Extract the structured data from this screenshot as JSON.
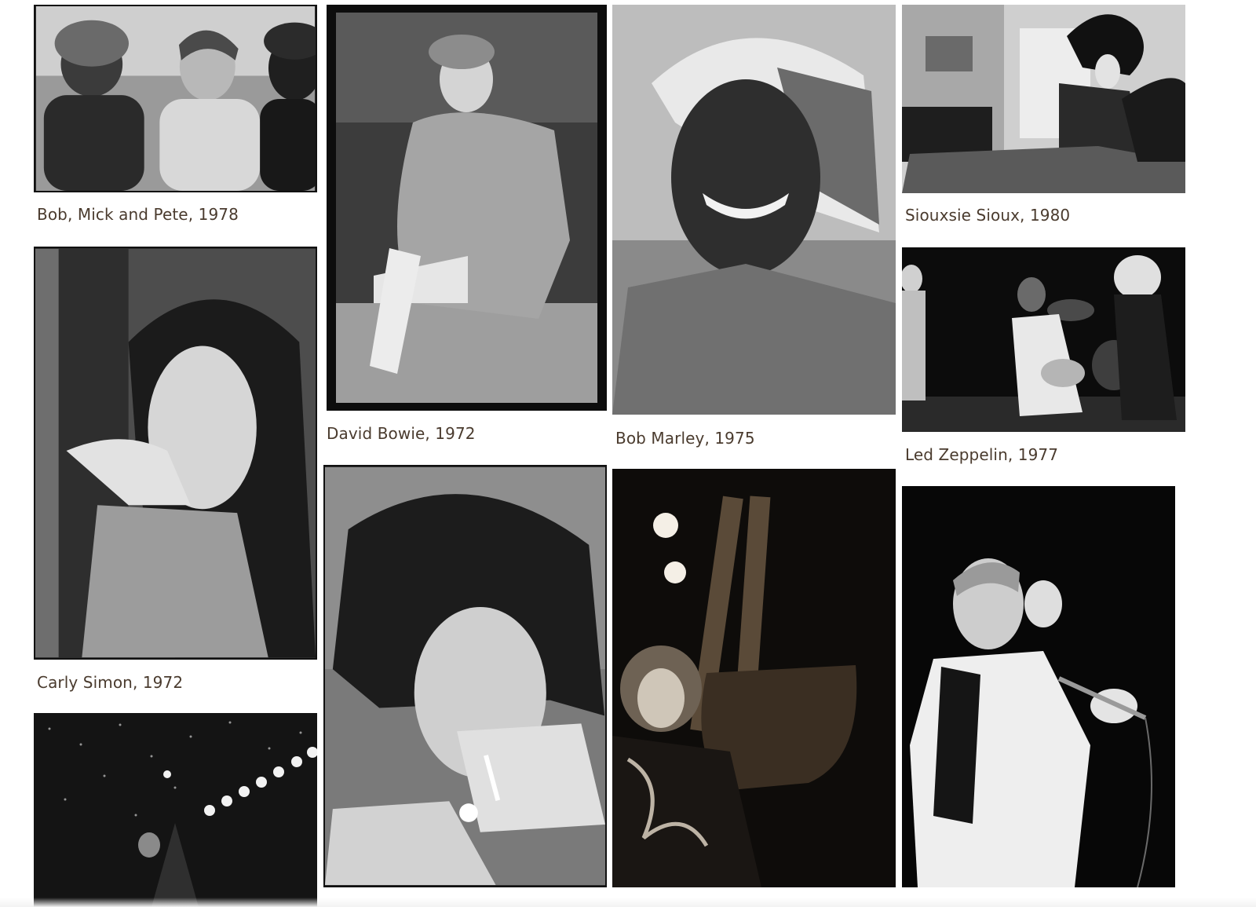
{
  "gallery": {
    "captions": {
      "bob_mick_pete": "Bob, Mick and Pete, 1978",
      "david_bowie": "David Bowie, 1972",
      "bob_marley": "Bob Marley, 1975",
      "siouxsie": "Siouxsie Sioux, 1980",
      "carly_simon": "Carly Simon, 1972",
      "led_zeppelin": "Led Zeppelin, 1977"
    },
    "photo_style": "black-and-white",
    "accent_caption_color": "#4a3b2e"
  }
}
